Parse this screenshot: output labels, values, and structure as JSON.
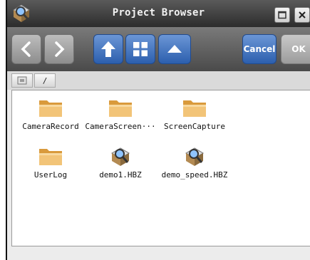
{
  "window": {
    "title": "Project Browser"
  },
  "toolbar": {
    "cancel_label": "Cancel",
    "ok_label": "OK"
  },
  "path": {
    "separator": "/"
  },
  "files": [
    {
      "name": "CameraRecord",
      "icon": "folder-icon"
    },
    {
      "name": "CameraScreen···",
      "icon": "folder-icon"
    },
    {
      "name": "ScreenCapture",
      "icon": "folder-icon"
    },
    {
      "name": "UserLog",
      "icon": "folder-icon"
    },
    {
      "name": "demo1.HBZ",
      "icon": "project-file-icon"
    },
    {
      "name": "demo_speed.HBZ",
      "icon": "project-file-icon"
    }
  ],
  "colors": {
    "accent_blue": "#2c5fae",
    "folder": "#e8b060"
  }
}
